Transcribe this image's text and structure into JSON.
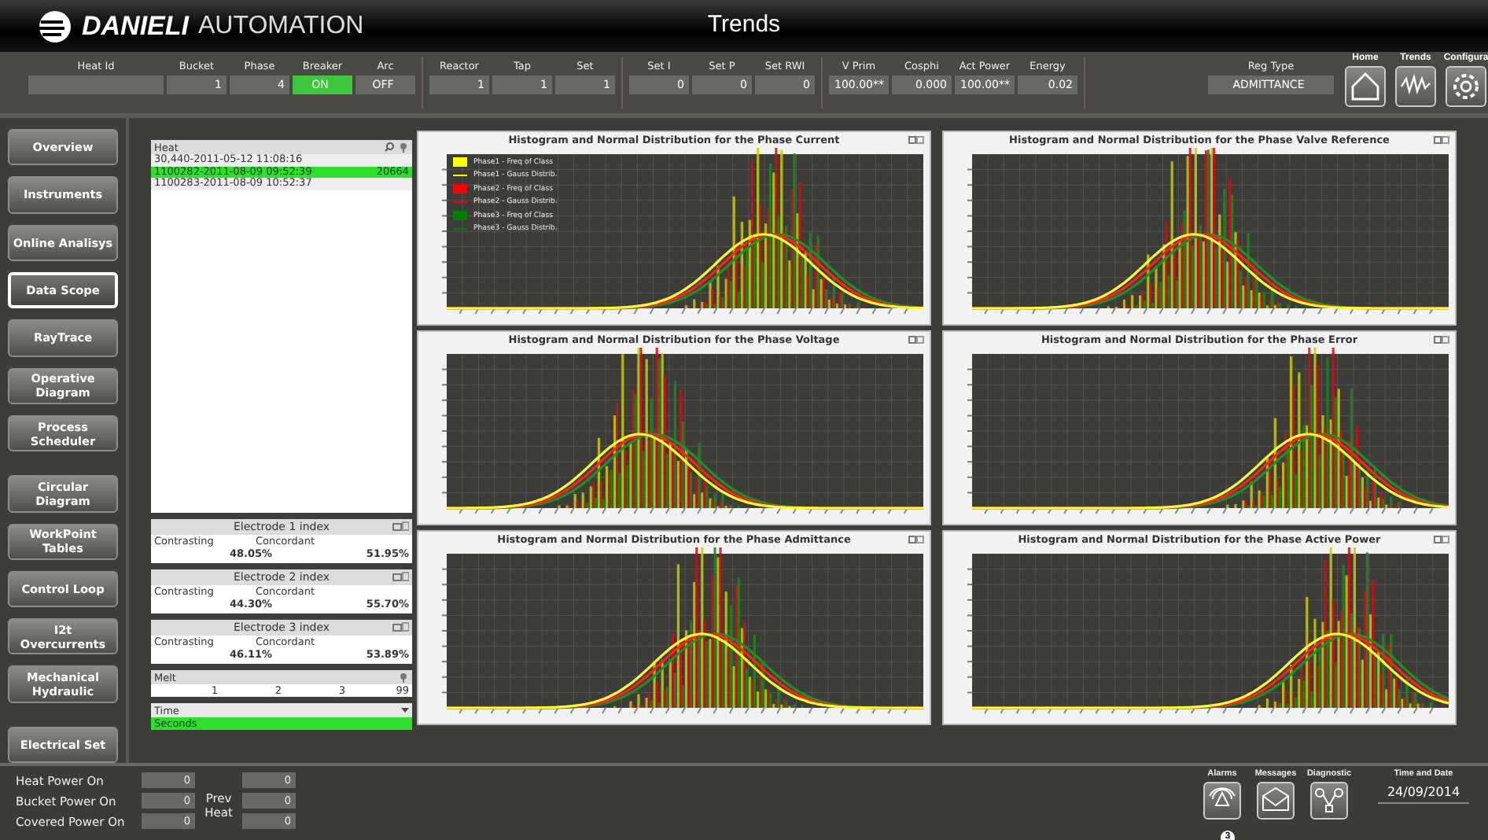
{
  "brand": {
    "name": "DANIELI",
    "suffix": "AUTOMATION"
  },
  "window": {
    "title": "Trends"
  },
  "header": {
    "groups": [
      [
        {
          "label": "Heat Id"
        },
        {
          "label": "Bucket",
          "value": "1"
        },
        {
          "label": "Phase",
          "value": "4"
        },
        {
          "label": "Breaker",
          "value": "ON",
          "on": true
        },
        {
          "label": "Arc",
          "value": "OFF",
          "on": false
        }
      ],
      [
        {
          "label": "Reactor",
          "value": "1"
        },
        {
          "label": "Tap",
          "value": "1"
        },
        {
          "label": "Set",
          "value": "1"
        }
      ],
      [
        {
          "label": "Set I",
          "value": "0"
        },
        {
          "label": "Set P",
          "value": "0"
        },
        {
          "label": "Set RWI",
          "value": "0"
        }
      ],
      [
        {
          "label": "V Prim",
          "value": "100.00**"
        },
        {
          "label": "Cosphi",
          "value": "0.000"
        },
        {
          "label": "Act Power",
          "value": "100.00**"
        },
        {
          "label": "Energy",
          "value": "0.02"
        }
      ]
    ],
    "reg_type": {
      "label": "Reg Type",
      "value": "ADMITTANCE"
    },
    "nav": [
      {
        "label": "Home",
        "kind": "home"
      },
      {
        "label": "Trends",
        "kind": "trends"
      },
      {
        "label": "Configura",
        "kind": "config"
      }
    ]
  },
  "sidebar": {
    "items": [
      {
        "label": "Overview",
        "selected": false
      },
      {
        "label": "Instruments",
        "selected": false
      },
      {
        "label": "Online Analisys",
        "selected": false
      },
      {
        "label": "Data Scope",
        "selected": true
      },
      {
        "label": "RayTrace",
        "selected": false
      },
      {
        "label": "Operative Diagram",
        "selected": false
      },
      {
        "label": "Process Scheduler",
        "selected": false
      },
      {
        "label": "Circular Diagram",
        "selected": false,
        "gap": true
      },
      {
        "label": "WorkPoint Tables",
        "selected": false
      },
      {
        "label": "Control Loop",
        "selected": false
      },
      {
        "label": "I2t Overcurrents",
        "selected": false
      },
      {
        "label": "Mechanical Hydraulic",
        "selected": false
      },
      {
        "label": "Electrical Set",
        "selected": false,
        "gap": true
      }
    ]
  },
  "heat_list": {
    "title": "Heat",
    "rows": [
      {
        "label": "30,440-2011-05-12 11:08:16",
        "selected": false
      },
      {
        "label": "1100282-2011-08-09 09:52:39",
        "count": "20664",
        "selected": true
      },
      {
        "label": "1100283-2011-08-09 10:52:37",
        "selected": false
      }
    ]
  },
  "electrodes": [
    {
      "title": "Electrode 1 index",
      "left_label": "Contrasting",
      "right_label": "Concordant",
      "left_value": "48.05%",
      "right_value": "51.95%"
    },
    {
      "title": "Electrode 2 index",
      "left_label": "Contrasting",
      "right_label": "Concordant",
      "left_value": "44.30%",
      "right_value": "55.70%"
    },
    {
      "title": "Electrode 3 index",
      "left_label": "Contrasting",
      "right_label": "Concordant",
      "left_value": "46.11%",
      "right_value": "53.89%"
    }
  ],
  "melt": {
    "title": "Melt",
    "cells": [
      "1",
      "2",
      "3",
      "99"
    ]
  },
  "time_select": {
    "label": "Time",
    "options": [
      {
        "label": "Seconds",
        "selected": true
      }
    ]
  },
  "charts": [
    {
      "title": "Histogram and Normal Distribution for the Phase Current",
      "legend": [
        {
          "label": "Phase1 - Freq of Class",
          "kind": "box",
          "color": "#ffff00"
        },
        {
          "label": "Phase1 - Gauss Distrib.",
          "kind": "line",
          "color": "#ffff00"
        },
        {
          "label": "Phase2 - Freq of Class",
          "kind": "box",
          "color": "#ff0000"
        },
        {
          "label": "Phase2 - Gauss Distrib.",
          "kind": "line",
          "color": "#ff0000"
        },
        {
          "label": "Phase3 - Freq of Class",
          "kind": "box",
          "color": "#008000"
        },
        {
          "label": "Phase3 - Gauss Distrib.",
          "kind": "line",
          "color": "#008000"
        }
      ]
    },
    {
      "title": "Histogram and Normal Distribution for the Phase Valve Reference"
    },
    {
      "title": "Histogram and Normal Distribution for the Phase Voltage"
    },
    {
      "title": "Histogram and Normal Distribution for the Phase Error"
    },
    {
      "title": "Histogram and Normal Distribution for the Phase Admittance"
    },
    {
      "title": "Histogram and Normal Distribution for the Phase Active Power"
    }
  ],
  "footer": {
    "counters": [
      {
        "label": "Heat Power On",
        "value": "0",
        "prev": "0"
      },
      {
        "label": "Bucket Power On",
        "value": "0",
        "prev": "0"
      },
      {
        "label": "Covered Power On",
        "value": "0",
        "prev": "0"
      }
    ],
    "prev_label": "Prev Heat",
    "buttons": [
      {
        "label": "Alarms",
        "kind": "alarm",
        "badge": "3"
      },
      {
        "label": "Messages",
        "kind": "mail"
      },
      {
        "label": "Diagnostic",
        "kind": "diag"
      }
    ],
    "date_label": "Time and Date",
    "date": "24/09/2014"
  }
}
